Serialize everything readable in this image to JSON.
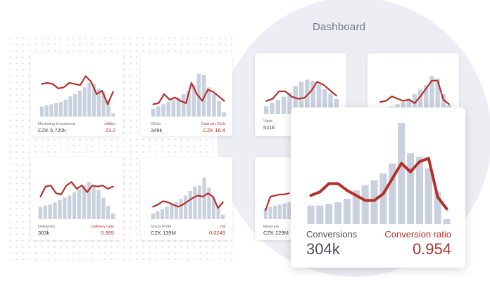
{
  "header": {
    "title": "Dashboard"
  },
  "colors": {
    "bar": "#c9d1de",
    "line": "#b5302a",
    "panel": "#eceef3"
  },
  "cards": [
    {
      "label_left": "Marketing Investment",
      "value_left": "CZK 5,720k",
      "label_right": "million",
      "value_right": "23.2",
      "chart_data": {
        "type": "bar+line",
        "bars": [
          18,
          20,
          22,
          24,
          26,
          30,
          36,
          40,
          46,
          52,
          60,
          58,
          50,
          44,
          28,
          6
        ],
        "line": [
          58,
          60,
          58,
          50,
          52,
          60,
          58,
          56,
          72,
          62,
          40,
          46,
          22,
          44
        ]
      }
    },
    {
      "label_left": "Clicks",
      "value_left": "349k",
      "label_right": "Cost per Click",
      "value_right": "CZK 16.4",
      "chart_data": {
        "type": "bar+line",
        "bars": [
          14,
          18,
          22,
          26,
          30,
          34,
          40,
          46,
          56,
          76,
          74,
          52,
          40,
          28,
          8
        ],
        "line": [
          22,
          24,
          40,
          30,
          34,
          28,
          24,
          60,
          40,
          28,
          48,
          44,
          36,
          28
        ]
      }
    },
    {
      "label_left": "Visits",
      "value_left": "521k",
      "label_right": "",
      "value_right": "",
      "chart_data": {
        "type": "bar+line",
        "bars": [
          14,
          20,
          26,
          32,
          40,
          52,
          60,
          64,
          62,
          54,
          46,
          38,
          28
        ],
        "line": [
          24,
          28,
          42,
          42,
          32,
          28,
          30,
          42,
          60,
          54,
          44,
          34
        ]
      }
    },
    {
      "label_left": "",
      "value_left": "",
      "label_right": "",
      "value_right": "",
      "chart_data": {
        "type": "bar+line",
        "bars": [
          10,
          14,
          18,
          22,
          26,
          32,
          40,
          48,
          56,
          72,
          68,
          40,
          20
        ],
        "line": [
          26,
          28,
          36,
          32,
          28,
          30,
          24,
          36,
          50,
          64,
          64,
          30,
          22
        ]
      }
    },
    {
      "label_left": "Deliveries",
      "value_left": "303k",
      "label_right": "Delivery ratio",
      "value_right": "0.995",
      "chart_data": {
        "type": "bar+line",
        "bars": [
          22,
          24,
          26,
          30,
          34,
          38,
          42,
          48,
          54,
          60,
          66,
          60,
          52,
          38,
          24,
          10
        ],
        "line": [
          40,
          58,
          60,
          46,
          44,
          60,
          66,
          54,
          60,
          48,
          60,
          58,
          60,
          54,
          58
        ]
      }
    },
    {
      "label_left": "Gross Profit",
      "value_left": "CZK 139M",
      "label_right": "mil",
      "value_right": "0.0249",
      "chart_data": {
        "type": "bar+line",
        "bars": [
          10,
          14,
          18,
          22,
          26,
          30,
          36,
          42,
          50,
          58,
          60,
          74,
          56,
          38,
          22,
          8
        ],
        "line": [
          22,
          26,
          32,
          30,
          26,
          22,
          26,
          32,
          38,
          42,
          40,
          46,
          40,
          20,
          30
        ]
      }
    },
    {
      "label_left": "Revenue",
      "value_left": "CZK 229M",
      "label_right": "",
      "value_right": "",
      "chart_data": {
        "type": "bar+line",
        "bars": [
          20,
          22,
          24,
          26,
          28,
          30
        ],
        "line": [
          16,
          40,
          42,
          44,
          44,
          46
        ]
      }
    },
    {
      "label_left": "Conversions",
      "value_left": "304k",
      "label_right": "Conversion ratio",
      "value_right": "0.954",
      "chart_data": {
        "type": "bar+line",
        "bars": [
          22,
          22,
          24,
          26,
          30,
          40,
          46,
          52,
          60,
          72,
          120,
          84,
          80,
          66,
          38,
          6
        ],
        "line": [
          34,
          38,
          48,
          48,
          40,
          34,
          28,
          28,
          36,
          54,
          72,
          62,
          74,
          78,
          32,
          18
        ]
      }
    }
  ]
}
